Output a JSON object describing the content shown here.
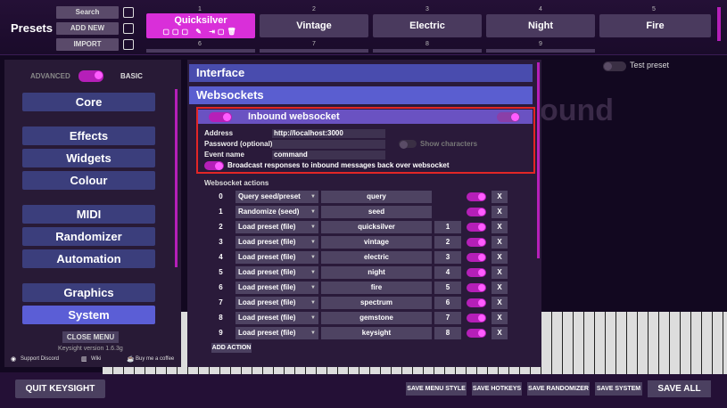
{
  "topbar": {
    "title": "Presets",
    "search": "Search",
    "add_new": "ADD NEW",
    "import": "IMPORT",
    "slots": [
      {
        "num": "1",
        "label": "Quicksilver"
      },
      {
        "num": "2",
        "label": "Vintage"
      },
      {
        "num": "3",
        "label": "Electric"
      },
      {
        "num": "4",
        "label": "Night"
      },
      {
        "num": "5",
        "label": "Fire"
      }
    ],
    "row2": [
      "6",
      "7",
      "8",
      "9"
    ]
  },
  "background_text": "ound",
  "test_preset": "Test preset",
  "sidebar": {
    "advanced": "ADVANCED",
    "basic": "BASIC",
    "items": [
      "Core",
      "Effects",
      "Widgets",
      "Colour",
      "MIDI",
      "Randomizer",
      "Automation",
      "Graphics",
      "System"
    ],
    "close_menu": "CLOSE MENU",
    "version": "Keysight version 1.6.3g",
    "links": [
      "Support Discord",
      "Wiki",
      "Buy me a coffee"
    ],
    "quit": "QUIT KEYSIGHT"
  },
  "main": {
    "interface": "Interface",
    "websockets": "Websockets",
    "inbound": {
      "title": "Inbound websocket",
      "address_label": "Address",
      "address": "http://localhost:3000",
      "password_label": "Password (optional)",
      "show_chars": "Show characters",
      "event_label": "Event name",
      "event": "command",
      "broadcast": "Broadcast responses to inbound messages back over websocket"
    },
    "actions_label": "Websocket actions",
    "actions": [
      {
        "n": "0",
        "type": "Query seed/preset",
        "value": "query",
        "slot": ""
      },
      {
        "n": "1",
        "type": "Randomize (seed)",
        "value": "seed",
        "slot": ""
      },
      {
        "n": "2",
        "type": "Load preset (file)",
        "value": "quicksilver",
        "slot": "1"
      },
      {
        "n": "3",
        "type": "Load preset (file)",
        "value": "vintage",
        "slot": "2"
      },
      {
        "n": "4",
        "type": "Load preset (file)",
        "value": "electric",
        "slot": "3"
      },
      {
        "n": "5",
        "type": "Load preset (file)",
        "value": "night",
        "slot": "4"
      },
      {
        "n": "6",
        "type": "Load preset (file)",
        "value": "fire",
        "slot": "5"
      },
      {
        "n": "7",
        "type": "Load preset (file)",
        "value": "spectrum",
        "slot": "6"
      },
      {
        "n": "8",
        "type": "Load preset (file)",
        "value": "gemstone",
        "slot": "7"
      },
      {
        "n": "9",
        "type": "Load preset (file)",
        "value": "keysight",
        "slot": "8"
      }
    ],
    "add_action": "ADD ACTION",
    "x": "X"
  },
  "bottom": {
    "save_menu_style": "SAVE MENU STYLE",
    "save_hotkeys": "SAVE HOTKEYS",
    "save_randomizer": "SAVE RANDOMIZER",
    "save_system": "SAVE SYSTEM",
    "save_all": "SAVE ALL"
  }
}
